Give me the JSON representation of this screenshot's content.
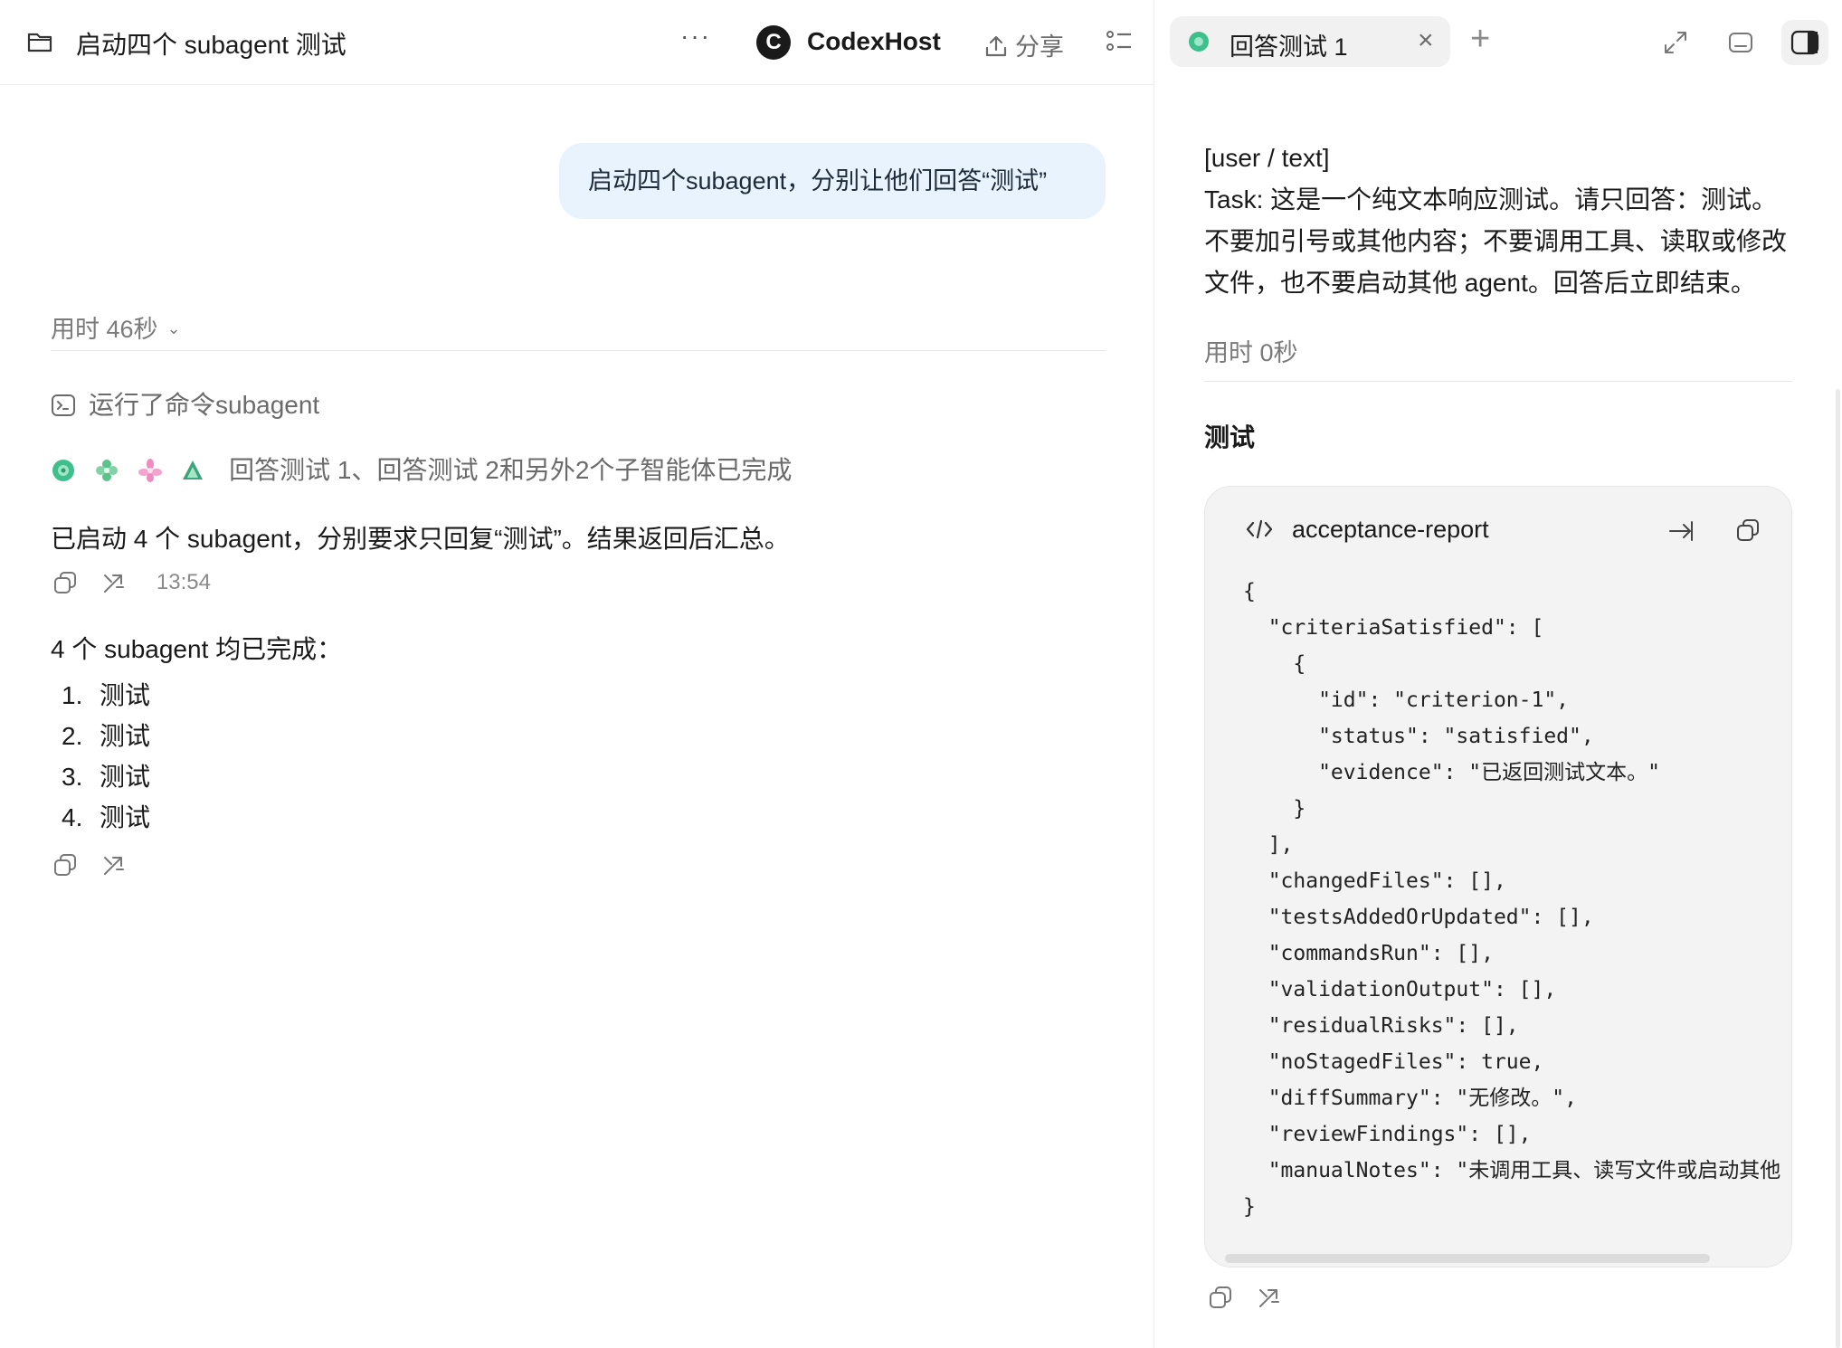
{
  "left_header": {
    "title": "启动四个 subagent 测试",
    "more": "···",
    "host_name": "CodexHost",
    "share_label": "分享"
  },
  "thread": {
    "user_message": "启动四个subagent，分别让他们回答“测试”",
    "elapsed": "用时 46秒",
    "command_label": "运行了命令subagent",
    "agents_status": "回答测试 1、回答测试 2和另外2个子智能体已完成",
    "assistant_message": "已启动 4 个 subagent，分别要求只回复“测试”。结果返回后汇总。",
    "message_time": "13:54",
    "summary_title": "4 个 subagent 均已完成：",
    "results": [
      {
        "num": "1.",
        "text": "测试"
      },
      {
        "num": "2.",
        "text": "测试"
      },
      {
        "num": "3.",
        "text": "测试"
      },
      {
        "num": "4.",
        "text": "测试"
      }
    ]
  },
  "right_header": {
    "tab_label": "回答测试 1",
    "tab_close": "×",
    "add_tab": "+"
  },
  "detail": {
    "prompt_tag": "[user / text]",
    "prompt_text": "Task: 这是一个纯文本响应测试。请只回答：测试。不要加引号或其他内容；不要调用工具、读取或修改文件，也不要启动其他 agent。回答后立即结束。",
    "elapsed": "用时 0秒",
    "answer": "测试",
    "code_title": "acceptance-report",
    "code_lines": [
      "{",
      "  \"criteriaSatisfied\": [",
      "    {",
      "      \"id\": \"criterion-1\",",
      "      \"status\": \"satisfied\",",
      "      \"evidence\": \"已返回测试文本。\"",
      "    }",
      "  ],",
      "  \"changedFiles\": [],",
      "  \"testsAddedOrUpdated\": [],",
      "  \"commandsRun\": [],",
      "  \"validationOutput\": [],",
      "  \"residualRisks\": [],",
      "  \"noStagedFiles\": true,",
      "  \"diffSummary\": \"无修改。\",",
      "  \"reviewFindings\": [],",
      "  \"manualNotes\": \"未调用工具、读写文件或启动其他",
      "}"
    ]
  },
  "colors": {
    "user_bubble": "#e9f3fd",
    "code_bg": "#f3f3f3",
    "muted_text": "#7a7a7a",
    "agent1": "#3fbf8c",
    "agent2": "#5ac28a",
    "agent3": "#f08ac0",
    "agent4": "#3aa57a"
  },
  "icons": {
    "folder": "folder-icon",
    "more": "more-horizontal-icon",
    "host": "codexhost-logo-icon",
    "share": "upload-share-icon",
    "list": "checklist-icon",
    "terminal": "terminal-icon",
    "copy": "copy-icon",
    "branch": "fork-icon",
    "code": "code-brackets-icon",
    "expand": "expand-icon",
    "minimize": "minimize-panel-icon",
    "sidebar": "sidebar-toggle-icon"
  }
}
